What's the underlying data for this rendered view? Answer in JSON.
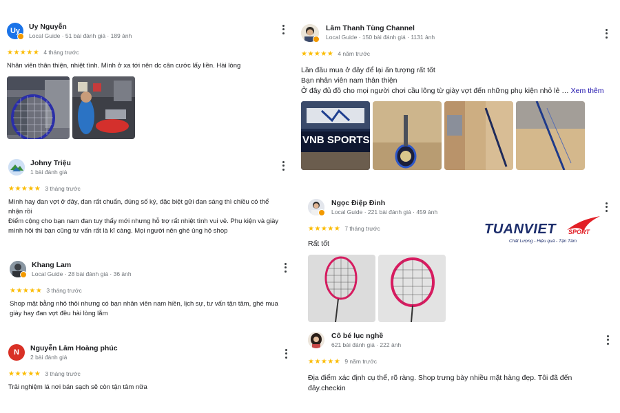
{
  "reviews": [
    {
      "name": "Uy Nguyễn",
      "meta": "Local Guide · 51 bài đánh giá · 189 ảnh",
      "avatar_initials": "Uy",
      "avatar_color": "#1a73e8",
      "stars": "★★★★★",
      "time": "4 tháng trước",
      "text": "Nhân viên thân thiện, nhiệt tình. Mình ở xa tới nên dc cân cước lấy liền. Hài lòng"
    },
    {
      "name": "Johny Triệu",
      "meta": "1 bài đánh giá",
      "stars": "★★★★★",
      "time": "3 tháng trước",
      "text": "Mình hay đan vợt ở đây, đan rất chuẩn, đúng số ký, đặc biệt gửi đan sáng thì chiều có thể nhận rồi\nĐiểm cộng cho bạn nam đan tuy thấy mới nhưng hỗ trợ rất nhiệt tình vui vẻ. Phụ kiện và giày mình hỏi thì bạn cũng tư vấn rất là kĩ càng. Mọi người nên ghé ủng hộ shop"
    },
    {
      "name": "Khang Lam",
      "meta": "Local Guide · 28 bài đánh giá · 36 ảnh",
      "stars": "★★★★★",
      "time": "3 tháng trước",
      "text": "Shop mặt bằng nhỏ thôi nhưng có bạn nhân viên nam hiền, lịch sự, tư vấn tận tâm, ghé mua giày hay đan vợt đều hài lòng lắm"
    },
    {
      "name": "Nguyễn Lâm Hoàng phúc",
      "meta": "2 bài đánh giá",
      "avatar_initials": "N",
      "avatar_color": "#d93025",
      "stars": "★★★★★",
      "time": "3 tháng trước",
      "text": "Trải nghiệm lá nơi bán sạch sẽ còn tận tâm nữa"
    },
    {
      "name": "Lâm Thanh Tùng Channel",
      "meta": "Local Guide · 150 bài đánh giá · 1131 ảnh",
      "stars": "★★★★★",
      "time": "4 năm trước",
      "text": "Lần đầu mua ở đây để lại ấn tượng rất tốt\nBạn nhân viên nam thân thiện\nỞ đây đủ đồ cho mọi người chơi cầu lông từ giày vợt đến những phụ kiện nhỏ lẻ …",
      "more_label": "Xem thêm",
      "photo_caption": "VNB SPORTS"
    },
    {
      "name": "Ngọc Điệp Đinh",
      "meta": "Local Guide · 221 bài đánh giá · 459 ảnh",
      "stars": "★★★★★",
      "time": "7 tháng trước",
      "text": "Rất tốt"
    },
    {
      "name": "Cô bé lục nghề",
      "meta": "621 bài đánh giá · 222 ảnh",
      "stars": "★★★★★",
      "time": "9 năm trước",
      "text": "Địa điểm xác định cụ thể, rõ ràng. Shop trưng bày nhiều mặt hàng đẹp. Tôi đã đến đây.checkin"
    }
  ],
  "logo": {
    "brand": "TUANVIET",
    "sport": "SPORT",
    "tagline": "Chất Lượng - Hiệu quả - Tận Tâm"
  },
  "colors": {
    "stars": "#fbbc04",
    "link": "#1a0dab",
    "logo_blue": "#1c2d6b",
    "logo_red": "#e21f26"
  }
}
